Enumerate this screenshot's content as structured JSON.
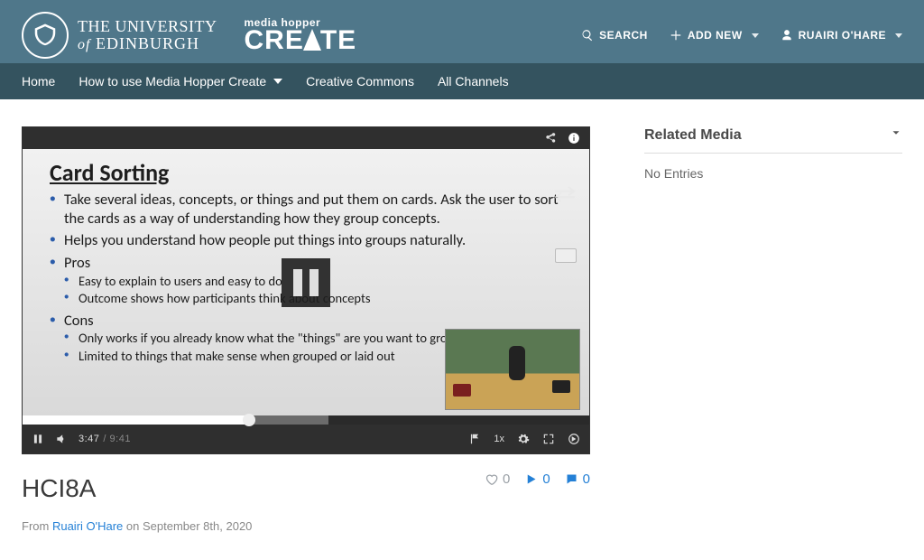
{
  "brand": {
    "uni_line1": "THE UNIVERSITY",
    "uni_of": "of",
    "uni_line2": " EDINBURGH",
    "create_top": "media hopper",
    "create_main_left": "CRE",
    "create_main_right": "TE"
  },
  "topActions": {
    "search": "SEARCH",
    "addNew": "ADD NEW",
    "user": "RUAIRI O'HARE"
  },
  "nav": {
    "home": "Home",
    "howto": "How to use Media Hopper Create",
    "cc": "Creative Commons",
    "channels": "All Channels"
  },
  "slide": {
    "title": "Card Sorting",
    "b1": "Take several ideas, concepts, or things and put them on cards. Ask the user to sort the cards as a way of understanding how they group concepts.",
    "b2": "Helps you understand how people put things into groups naturally.",
    "pros_label": "Pros",
    "pros1": "Easy to explain to users and easy to do",
    "pros2": "Outcome shows how participants think about concepts",
    "cons_label": "Cons",
    "cons1": "Only works if you already know what the \"things\" are you want to group",
    "cons2": "Limited to things that make sense when grouped or laid out"
  },
  "player": {
    "current": "3:47",
    "total": "/ 9:41",
    "speed": "1x"
  },
  "video": {
    "title": "HCI8A",
    "likes": "0",
    "plays": "0",
    "comments": "0"
  },
  "meta": {
    "from": "From ",
    "author": "Ruairi O'Hare",
    "on": " on ",
    "date": "September 8th, 2020"
  },
  "sidebar": {
    "related": "Related Media",
    "empty": "No Entries"
  }
}
